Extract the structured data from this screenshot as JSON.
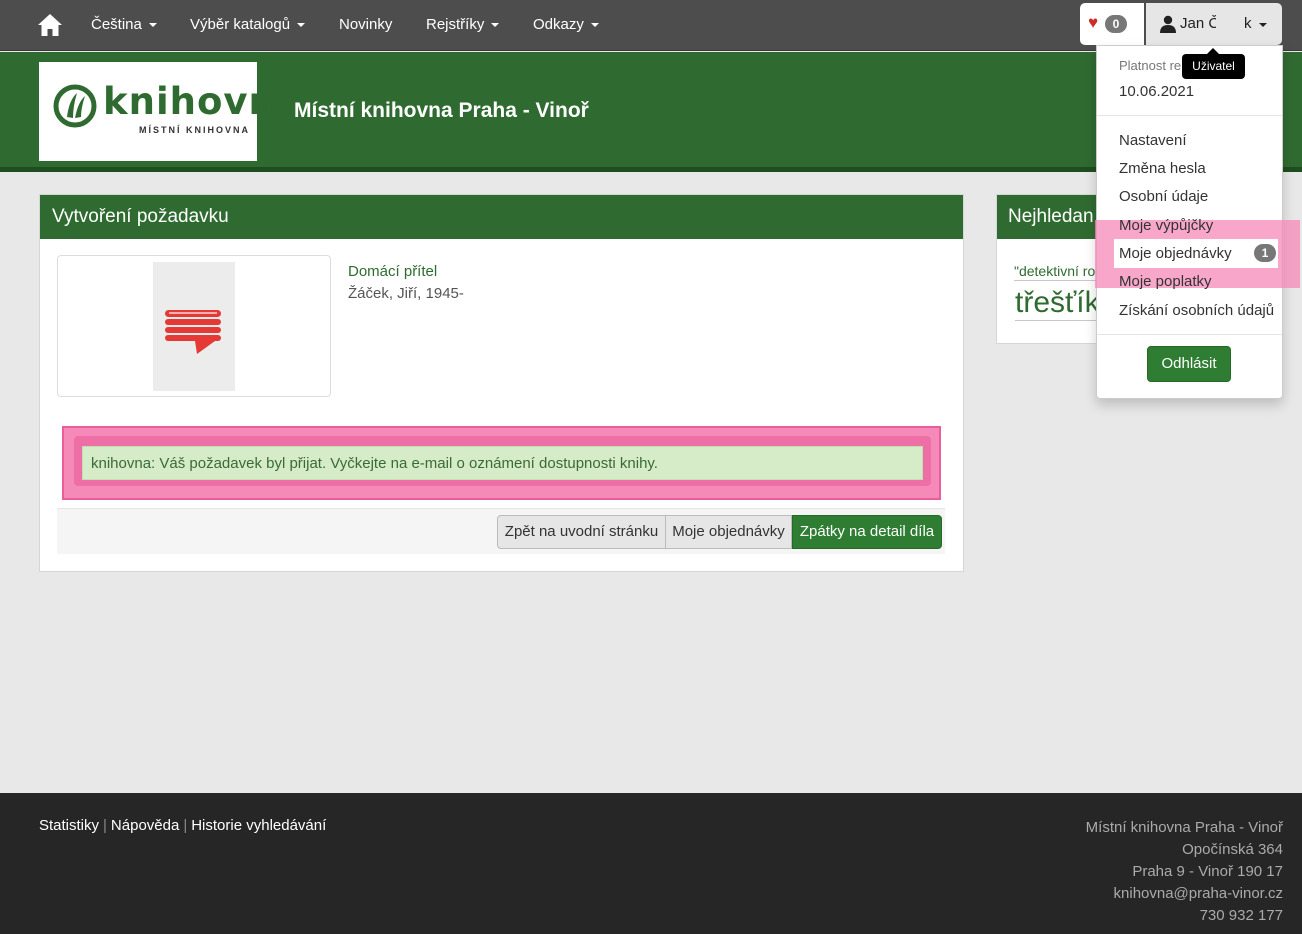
{
  "nav": {
    "home_icon": "home-icon",
    "items": [
      {
        "label": "Čeština"
      },
      {
        "label": "Výběr katalogů"
      },
      {
        "label": "Novinky"
      },
      {
        "label": "Rejstříky"
      },
      {
        "label": "Odkazy"
      }
    ],
    "favorites_count": "0",
    "user_name": "Jan Č",
    "user_name_end": "k"
  },
  "header": {
    "logo_word": "knihovna",
    "logo_sub": "MÍSTNÍ KNIHOVNA",
    "site_title": "Místní knihovna Praha - Vinoř"
  },
  "main": {
    "title": "Vytvoření požadavku",
    "book_title": "Domácí přítel",
    "book_author": "Žáček, Jiří, 1945-",
    "alert": "knihovna: Váš požadavek byl přijat. Vyčkejte na e-mail o oznámení dostupnosti knihy.",
    "buttons": {
      "home": "Zpět na uvodní stránku",
      "orders": "Moje objednávky",
      "detail": "Zpátky na detail díla"
    }
  },
  "side": {
    "title": "Nejhledan",
    "tag": "\"detektivní ro",
    "word": "třešťíko"
  },
  "dropdown": {
    "validity_label": "Platnost re",
    "validity_date": "10.06.2021",
    "items": [
      {
        "label": "Nastavení"
      },
      {
        "label": "Změna hesla"
      },
      {
        "label": "Osobní údaje"
      },
      {
        "label": "Moje výpůjčky"
      },
      {
        "label": "Moje objednávky",
        "badge": "1"
      },
      {
        "label": "Moje poplatky"
      },
      {
        "label": "Získání osobních údajů"
      }
    ],
    "logout": "Odhlásit"
  },
  "tooltip": "Uživatel",
  "footer": {
    "links": [
      "Statistiky",
      "Nápověda",
      "Historie vyhledávání"
    ],
    "address": [
      "Místní knihovna Praha - Vinoř",
      "Opočínská 364",
      "Praha 9 - Vinoř 190 17",
      "knihovna@praha-vinor.cz",
      "730 932 177"
    ]
  },
  "colors": {
    "brand_green": "#2f6b30",
    "button_green": "#2e7d32",
    "highlight_pink": "#f58ab8",
    "navbar": "#4d4d4d",
    "footer": "#262626"
  }
}
